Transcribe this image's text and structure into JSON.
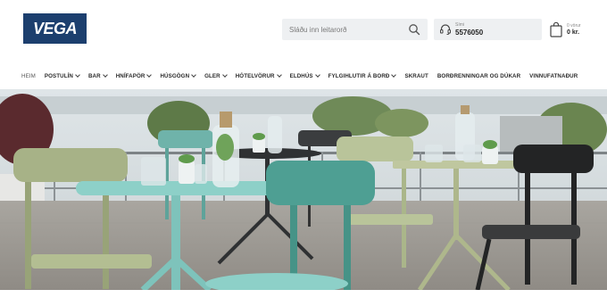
{
  "header": {
    "logo_text": "VEGA",
    "search": {
      "placeholder": "Sláðu inn leitarorð"
    },
    "phone": {
      "label": "Sími",
      "number": "5576050"
    },
    "cart": {
      "label": "0 vörur",
      "amount": "0 kr."
    }
  },
  "nav": {
    "items": [
      {
        "label": "Heim",
        "dropdown": false
      },
      {
        "label": "Postulín",
        "dropdown": true
      },
      {
        "label": "Bar",
        "dropdown": true
      },
      {
        "label": "Hnífapör",
        "dropdown": true
      },
      {
        "label": "Húsgögn",
        "dropdown": true
      },
      {
        "label": "Gler",
        "dropdown": true
      },
      {
        "label": "Hótelvörur",
        "dropdown": true
      },
      {
        "label": "Eldhús",
        "dropdown": true
      },
      {
        "label": "Fylgihlutir á borð",
        "dropdown": true
      },
      {
        "label": "Skraut",
        "dropdown": false
      },
      {
        "label": "Borðrenningar og dúkar",
        "dropdown": false
      },
      {
        "label": "Vinnufatnaður",
        "dropdown": false
      }
    ]
  },
  "colors": {
    "brand": "#1c3f6e",
    "search_bg": "#eef0f2",
    "text": "#2a2a2a"
  },
  "icons": {
    "search": "search-icon",
    "phone": "headset-icon",
    "cart": "shopping-bag-icon"
  }
}
